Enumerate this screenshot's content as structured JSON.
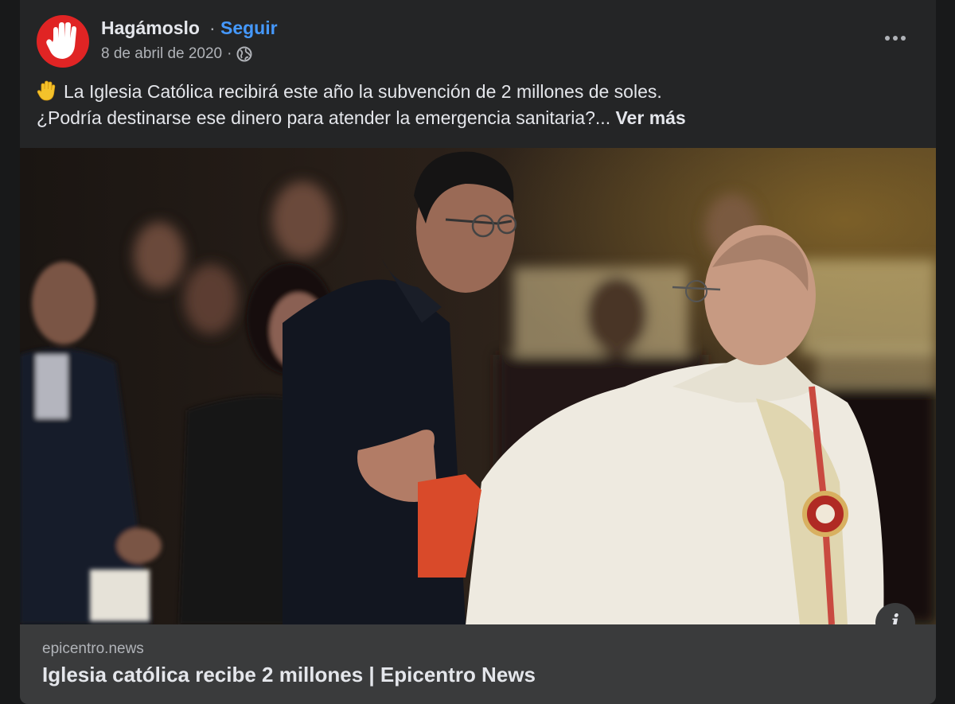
{
  "post": {
    "page_name": "Hagámoslo",
    "separator": "·",
    "follow_label": "Seguir",
    "date": "8 de abril de 2020",
    "meta_separator": "·",
    "privacy_icon": "globe-icon",
    "more_icon": "more-options-icon",
    "text_line1": "La Iglesia Católica recibirá este año la subvención de 2 millones de soles.",
    "text_line2": "¿Podría destinarse ese dinero para atender la emergencia sanitaria?...",
    "see_more_label": "Ver más",
    "emoji": "raised-hand-icon"
  },
  "link_preview": {
    "domain": "epicentro.news",
    "title": "Iglesia católica recibe 2 millones | Epicentro News",
    "info_label": "i"
  },
  "colors": {
    "background": "#18191a",
    "card": "#242526",
    "accent_blue": "#4599ff",
    "avatar_red": "#e02424",
    "link_box": "#3a3b3c"
  }
}
